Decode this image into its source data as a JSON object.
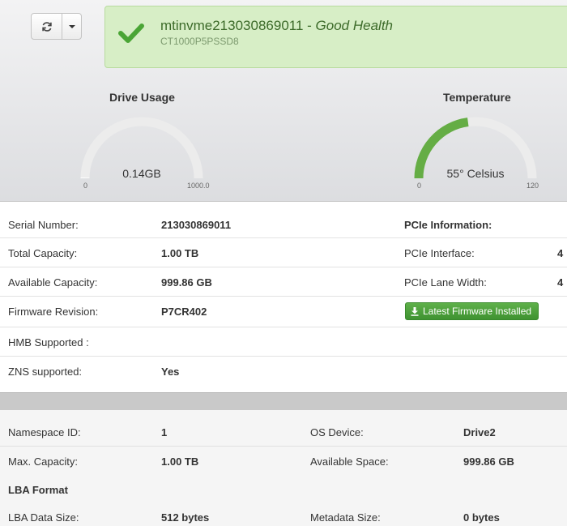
{
  "toolbar": {
    "refresh_icon": "refresh-icon",
    "dropdown_icon": "caret-down-icon"
  },
  "health": {
    "drive_name": "mtinvme213030869011",
    "separator": " - ",
    "status": "Good Health",
    "model": "CT1000P5PSSD8",
    "status_color": "#4aa535"
  },
  "gauges": {
    "usage": {
      "label": "Drive Usage",
      "value": "0.14GB",
      "min": "0",
      "max": "1000.0",
      "fill_fraction": 0.00014
    },
    "temperature": {
      "label": "Temperature",
      "value": "55° Celsius",
      "min": "0",
      "max": "120",
      "fill_fraction": 0.458,
      "fill_color": "#65ad45"
    }
  },
  "drive_info": {
    "serial_label": "Serial Number:",
    "serial_value": "213030869011",
    "pcie_header": "PCIe Information:",
    "capacity_label": "Total Capacity:",
    "capacity_value": "1.00 TB",
    "pcie_interface_label": "PCIe Interface:",
    "pcie_interface_value": "4",
    "available_label": "Available Capacity:",
    "available_value": "999.86 GB",
    "lane_width_label": "PCIe Lane Width:",
    "lane_width_value": "4",
    "firmware_label": "Firmware Revision:",
    "firmware_value": "P7CR402",
    "firmware_button": "Latest Firmware Installed",
    "hmb_label": "HMB Supported :",
    "zns_label": "ZNS supported:",
    "zns_value": "Yes"
  },
  "namespace": {
    "ns_id_label": "Namespace ID:",
    "ns_id_value": "1",
    "os_device_label": "OS Device:",
    "os_device_value": "Drive2",
    "max_capacity_label": "Max. Capacity:",
    "max_capacity_value": "1.00 TB",
    "available_space_label": "Available Space:",
    "available_space_value": "999.86 GB",
    "lba_header": "LBA Format",
    "lba_size_label": "LBA Data Size:",
    "lba_size_value": "512 bytes",
    "metadata_label": "Metadata Size:",
    "metadata_value": "0 bytes"
  }
}
